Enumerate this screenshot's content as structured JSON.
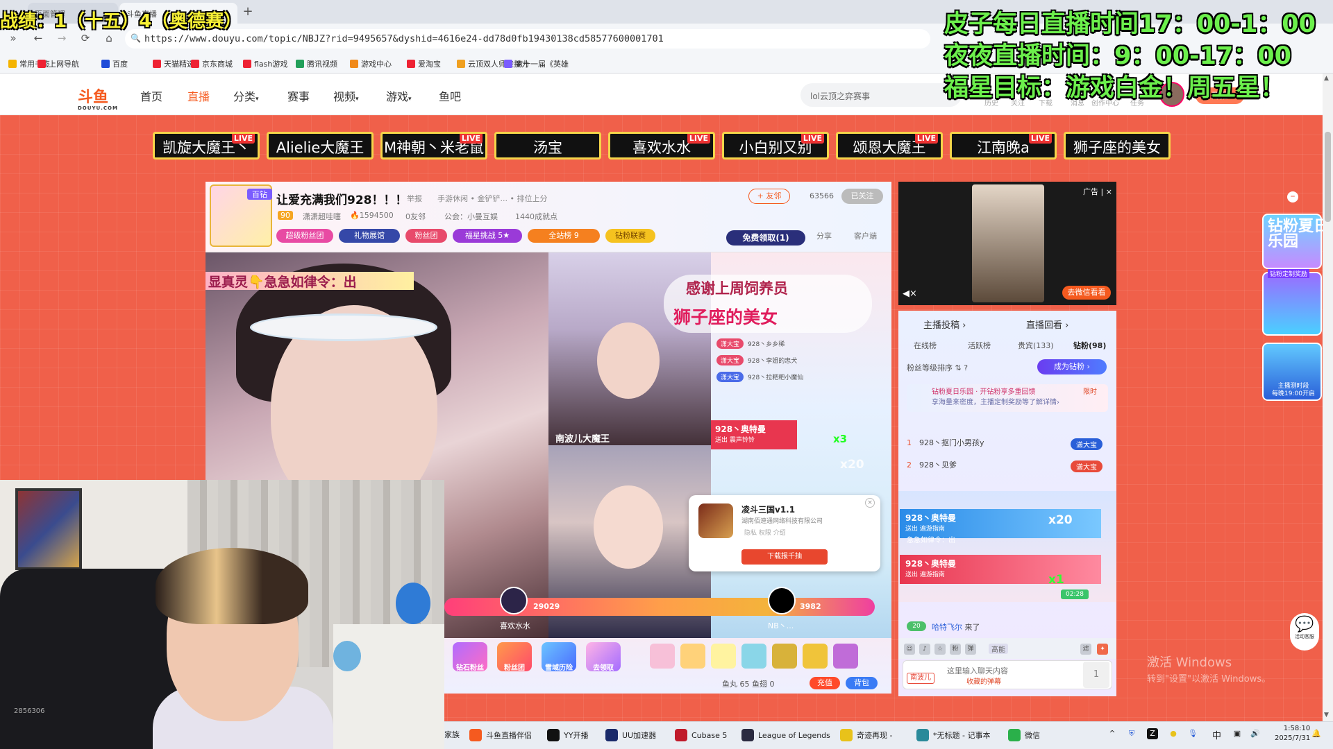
{
  "browser": {
    "tab1": "页面管理",
    "tab2": "斗鱼直播",
    "new_tab": "+",
    "url": "https://www.douyu.com/topic/NBJZ?rid=9495657&dyshid=4616e24-dd78d0fb19430138cd58577600001701",
    "nav": [
      "»",
      "←",
      "→",
      "⟳",
      "⌂"
    ],
    "bookmarks": [
      "常用书签",
      "上网导航",
      "百度",
      "天猫精选",
      "京东商城",
      "flash游戏",
      "腾讯视频",
      "游戏中心",
      "爱淘宝",
      "云顶双人师徒接力",
      "第十一届《英雄"
    ],
    "bookmark_colors": [
      "#f5b400",
      "#e23",
      "#1e4bd8",
      "#e23",
      "#e23",
      "#e23",
      "#22a05a",
      "#f08a1a",
      "#e23",
      "#f0a020",
      "#7a5cff"
    ]
  },
  "site": {
    "logo": "斗鱼",
    "logo_sub": "DOUYU.COM",
    "nav": [
      "首页",
      "直播",
      "分类",
      "赛事",
      "视频",
      "游戏",
      "鱼吧"
    ],
    "search_placeholder": "lol云顶之弈赛事",
    "header_links": [
      "历史",
      "关注",
      "下载",
      "消息",
      "创作中心",
      "任务"
    ],
    "open_live": "开播"
  },
  "anchors": [
    {
      "name": "凯旋大魔王丶",
      "live": true
    },
    {
      "name": "Alielie大魔王",
      "live": false
    },
    {
      "name": "M神朝丶米老鼠",
      "live": true
    },
    {
      "name": "汤宝",
      "live": false
    },
    {
      "name": "喜欢水水",
      "live": true
    },
    {
      "name": "小白别又别",
      "live": true
    },
    {
      "name": "颂恩大魔王",
      "live": true
    },
    {
      "name": "江南晚a",
      "live": true
    },
    {
      "name": "狮子座的美女",
      "live": false
    }
  ],
  "live_tag": "LIVE",
  "room": {
    "badge": "百钻",
    "title": "让爱充满我们928！！！",
    "sub": [
      "举报",
      "手游休闲 • 金铲铲... • 排位上分"
    ],
    "level": "90",
    "anchor_name": "潇潇超哇噻",
    "heat": "1594500",
    "friends": "0友邻",
    "guild": "公会：小曼互娱",
    "achievements": "1440成就点",
    "pills": [
      {
        "label": "超级粉丝团",
        "color": "#e84aa3"
      },
      {
        "label": "礼物展馆",
        "color": "#3548a8"
      },
      {
        "label": "粉丝团",
        "color": "#e84a6b"
      },
      {
        "label": "福星挑战  5★",
        "color": "#9a3ad8"
      },
      {
        "label": "全站榜      9",
        "color": "#f5801f"
      },
      {
        "label": "钻粉联赛",
        "color": "#f5c21f"
      }
    ],
    "follow": "+ 友邻",
    "follow_count": "63566",
    "followed": "已关注",
    "free_gift": "免费领取(1)",
    "share": "分享",
    "client": "客户端",
    "tabs_label": [
      "主播投稿",
      "直播回看"
    ]
  },
  "video": {
    "banner": "显真灵👇急急如律令：出",
    "mid_label": "南波儿大魔王",
    "thanks_line1": "感谢上周饲养员",
    "thanks_line2": "狮子座的美女",
    "rank_rows": [
      {
        "tag": "潇大宝",
        "name": "928丶乡乡稀"
      },
      {
        "tag": "潇大宝",
        "name": "928丶李姐的忠犬"
      },
      {
        "tag": "潇大宝",
        "name": "928丶拉粑粑小魔仙"
      }
    ],
    "gift_sender": "928丶奥特曼",
    "gift_action": "送出 震声铃铃",
    "gift_count": "x3",
    "gift_count2": "x20",
    "pk_left_score": "29029",
    "pk_left_name": "喜欢水水",
    "pk_right_score": "3982",
    "pk_right_name": "NB丶..."
  },
  "app_popup": {
    "name": "凌斗三国v1.1",
    "company": "湖南佰速通网络科技有限公司",
    "links": "隐私   权限   介绍",
    "download": "下载报千抽",
    "close": "×"
  },
  "gift_bar": {
    "labels": [
      "钻石粉丝",
      "粉丝团",
      "雪域历险",
      "去领取"
    ],
    "fish_ball": "鱼丸 65",
    "fish_fin": "鱼翅 0",
    "recharge": "充值",
    "backpack": "背包"
  },
  "ad": {
    "label": "广告 | ×",
    "cta": "去微信看看",
    "mute": "◀×"
  },
  "sidebar": {
    "tabs": [
      "主播投稿 ›",
      "直播回看 ›"
    ],
    "sub_tabs": [
      "在线榜",
      "活跃榜",
      "贵宾(133)",
      "钻粉(98)"
    ],
    "fan_rank": "粉丝等级排序 ⇅ ?",
    "become_diamond": "成为钻粉 ›",
    "summer_l1": "钻粉夏日乐园 · 开钻粉享多重回馈",
    "summer_l2": "享海量来密度，主播定制奖励等了解详情›",
    "limited": "限时",
    "rank": [
      {
        "n": "1",
        "name": "928丶抠门小男孩y",
        "badge": "潇大宝"
      },
      {
        "n": "2",
        "name": "928丶见爹",
        "badge": "潇大宝"
      }
    ],
    "chat_gifts": [
      {
        "sender": "928丶奥特曼",
        "action": "送出 遍游指南",
        "count": "x20"
      },
      {
        "sender": "928丶奥特曼",
        "action": "送出 遍游指南",
        "count": "x1"
      }
    ],
    "chat_banner": "急急如律令：出",
    "timer": "02:28",
    "enter_level": "20",
    "enter_user": "哈特飞尔",
    "enter_text": "来了",
    "hd": "高能",
    "fan_badge": "南波儿",
    "input_placeholder": "这里输入聊天内容",
    "collect": "收藏的弹幕",
    "send": "1"
  },
  "activation": {
    "line1": "激活 Windows",
    "line2": "转到\"设置\"以激活 Windows。"
  },
  "rail": {
    "summer": "钻粉夏日乐园",
    "diamond_tag": "钻粉定制奖励",
    "gift": "主播测时段\n每晚19:00开启",
    "cs": "活动客服",
    "minus": "–"
  },
  "cam": {
    "watermark": "2856306"
  },
  "taskbar": {
    "items": [
      "家族",
      "斗鱼直播伴侣",
      "YY开播",
      "UU加速器",
      "Cubase 5",
      "League of Legends",
      "奇迹再现 -",
      "*无标题 - 记事本",
      "微信"
    ],
    "item_colors": [
      "#e84a3a",
      "#f55a1f",
      "#111",
      "#1a2a6a",
      "#c01a2a",
      "#2a2a40",
      "#e8c21a",
      "#2a8a9a",
      "#2ab04a"
    ],
    "lang": "中",
    "time": "1:58:10",
    "date": "2025/7/31"
  },
  "overlay": {
    "score": "战绩：1（十五）4（奥德赛）",
    "line1": "皮子每日直播时间17：00-1：00",
    "line2": "夜夜直播时间：9：00-17：00",
    "line3": "福星目标：游戏白金！周五星！"
  }
}
